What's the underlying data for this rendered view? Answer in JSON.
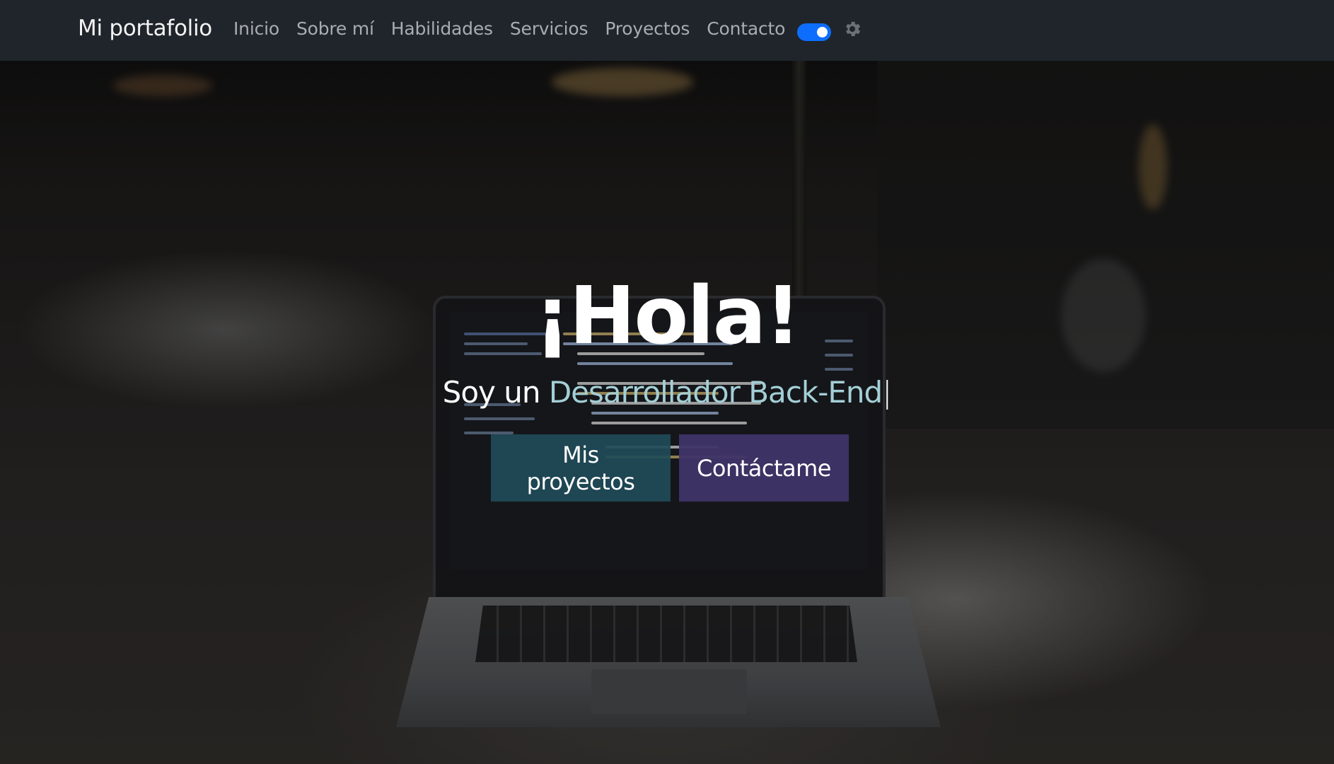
{
  "navbar": {
    "brand": "Mi portafolio",
    "links": [
      "Inicio",
      "Sobre mí",
      "Habilidades",
      "Servicios",
      "Proyectos",
      "Contacto"
    ],
    "theme_toggle_on": true,
    "toggle_color": "#0d6efd",
    "gear_icon": "gear-icon"
  },
  "hero": {
    "title": "¡Hola!",
    "subtitle_prefix": "Soy un ",
    "subtitle_typed": "Desarrollador Back-End",
    "cursor": "|",
    "typed_color": "#a3cfd6",
    "buttons": {
      "projects": "Mis proyectos",
      "contact": "Contáctame"
    },
    "button_colors": {
      "projects": "#204b58",
      "contact": "#3e3468"
    }
  }
}
